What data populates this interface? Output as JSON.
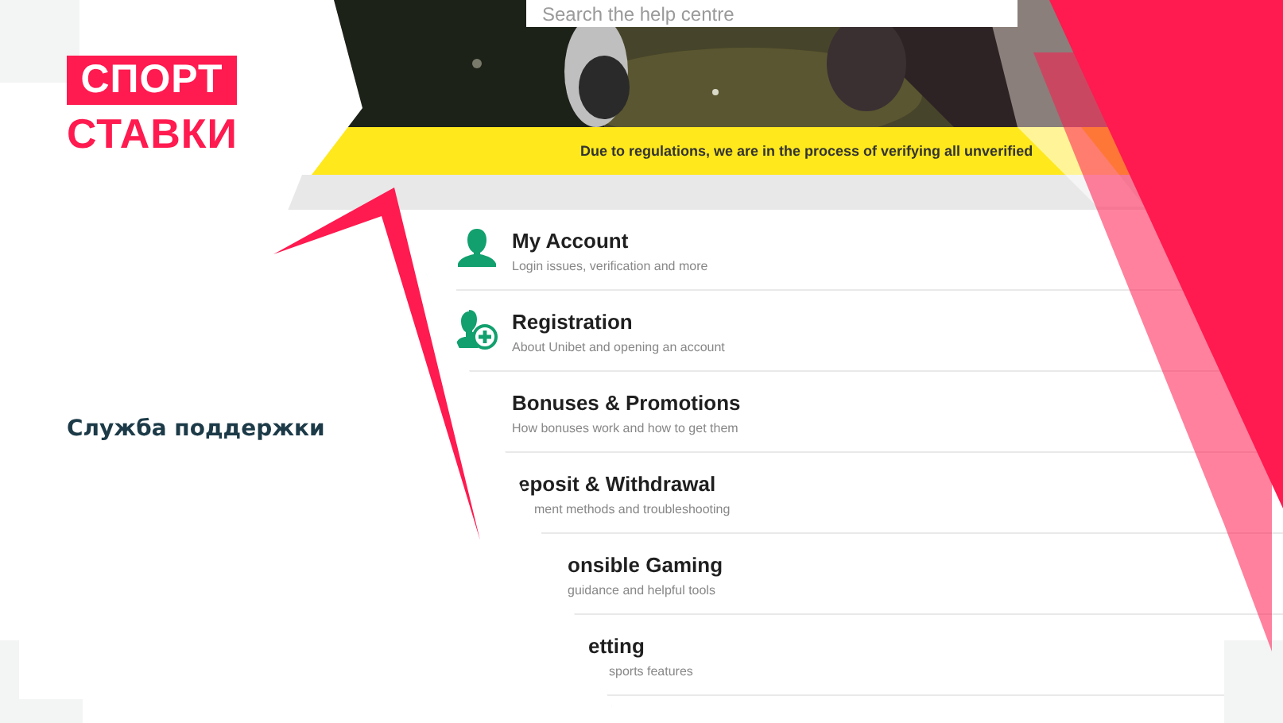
{
  "logo": {
    "top": "СПОРТ",
    "bottom": "СТАВКИ"
  },
  "heading": "Служба поддержки",
  "help_page": {
    "search": {
      "placeholder": "Search the help centre"
    },
    "notice": "Due to regulations, we are in the process of verifying all unverified",
    "categories": [
      {
        "title": "My Account",
        "subtitle": "Login issues, verification and more",
        "kind": "user"
      },
      {
        "title": "Registration",
        "subtitle": "About Unibet and opening an account",
        "kind": "user-add"
      },
      {
        "title": "Bonuses & Promotions",
        "subtitle": "How bonuses work and how to get them"
      },
      {
        "title": "eposit & Withdrawal",
        "subtitle": "ment methods and troubleshooting"
      },
      {
        "title": "onsible Gaming",
        "subtitle": "guidance and helpful tools"
      },
      {
        "title": "etting",
        "subtitle": "sports features"
      }
    ]
  }
}
